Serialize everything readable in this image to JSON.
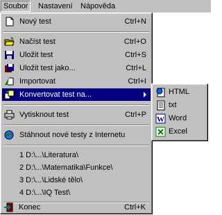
{
  "menubar": [
    {
      "label": "Soubor",
      "underline": "S"
    },
    {
      "label": "Nastavení",
      "underline": "N"
    },
    {
      "label": "Nápověda",
      "underline": "N"
    }
  ],
  "menu": {
    "items": [
      {
        "label": "Nový test",
        "shortcut": "Ctrl+N",
        "icon": "new-document-icon"
      },
      {
        "label": "Načíst test",
        "shortcut": "Ctrl+O",
        "icon": "open-folder-icon"
      },
      {
        "label": "Uložit test",
        "shortcut": "Ctrl+S",
        "icon": "save-disk-icon"
      },
      {
        "label": "Uložit test jako...",
        "shortcut": "Ctrl+L",
        "icon": "save-as-icon"
      },
      {
        "label": "Importovat",
        "shortcut": "Ctrl+I",
        "icon": "import-icon"
      },
      {
        "label": "Konvertovat test na...",
        "shortcut": "",
        "icon": "convert-icon"
      },
      {
        "label": "Vytisknout test",
        "shortcut": "Ctrl+P",
        "icon": "printer-icon"
      },
      {
        "label": "Stáhnout nové testy z Internetu",
        "shortcut": "",
        "icon": "download-internet-icon"
      },
      {
        "label": "1 D:\\...\\Literatura\\",
        "shortcut": ""
      },
      {
        "label": "2 D:\\...\\Matematika\\Funkce\\",
        "shortcut": ""
      },
      {
        "label": "3 D:\\...\\Lidské tělo\\",
        "shortcut": ""
      },
      {
        "label": "4 D:\\...\\IQ Test\\",
        "shortcut": ""
      },
      {
        "label": "Konec",
        "shortcut": "Ctrl+K",
        "icon": "exit-door-icon"
      }
    ]
  },
  "submenu": {
    "items": [
      {
        "label": "HTML",
        "icon": "html-icon"
      },
      {
        "label": "txt",
        "icon": "text-file-icon"
      },
      {
        "label": "Word",
        "icon": "word-icon"
      },
      {
        "label": "Excel",
        "icon": "excel-icon"
      }
    ]
  },
  "colors": {
    "menu_bg": "#c0c0c0",
    "highlight": "#000080"
  }
}
